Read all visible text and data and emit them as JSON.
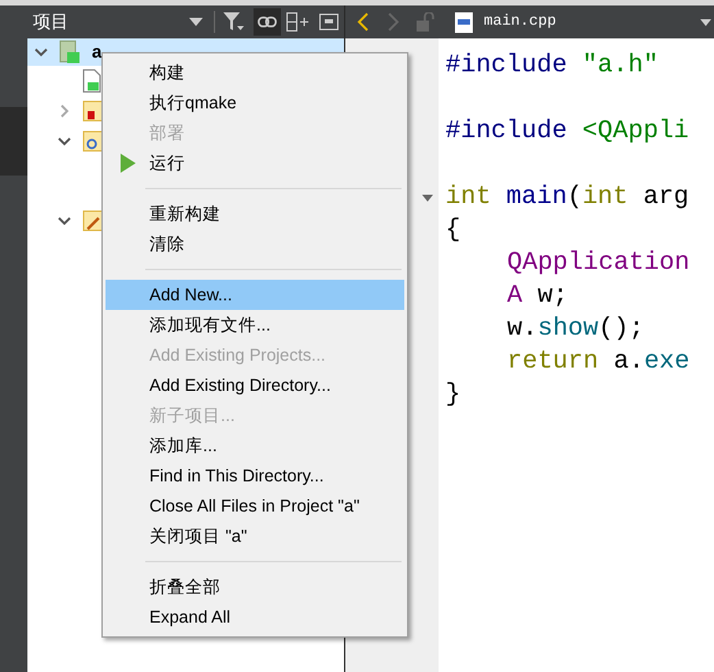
{
  "projects_header": {
    "title": "项目"
  },
  "editor_toolbar": {
    "file_name": "main.cpp"
  },
  "tree": [
    {
      "label": "a",
      "kind": "project",
      "selected": true,
      "expanded": true,
      "children": [
        {
          "kind": "pro-file"
        },
        {
          "kind": "headers",
          "expanded": false
        },
        {
          "kind": "sources",
          "expanded": true
        },
        {
          "kind": "forms",
          "expanded": true
        }
      ]
    }
  ],
  "context_menu": [
    {
      "label": "构建",
      "disabled": false,
      "selected": false
    },
    {
      "label": "执行qmake",
      "disabled": false,
      "selected": false
    },
    {
      "label": "部署",
      "disabled": true,
      "selected": false
    },
    {
      "kind": "run",
      "label": "运行",
      "disabled": false,
      "selected": false
    },
    {
      "kind": "separator"
    },
    {
      "label": "重新构建",
      "disabled": false,
      "selected": false
    },
    {
      "label": "清除",
      "disabled": false,
      "selected": false
    },
    {
      "kind": "separator"
    },
    {
      "label": "Add New...",
      "disabled": false,
      "selected": true
    },
    {
      "label": "添加现有文件...",
      "disabled": false,
      "selected": false
    },
    {
      "label": "Add Existing Projects...",
      "disabled": true,
      "selected": false
    },
    {
      "label": "Add Existing Directory...",
      "disabled": false,
      "selected": false
    },
    {
      "label": "新子项目...",
      "disabled": true,
      "selected": false
    },
    {
      "label": "添加库...",
      "disabled": false,
      "selected": false
    },
    {
      "label": "Find in This Directory...",
      "disabled": false,
      "selected": false
    },
    {
      "label": "Close All Files in Project \"a\"",
      "disabled": false,
      "selected": false
    },
    {
      "label": "关闭项目 \"a\"",
      "disabled": false,
      "selected": false
    },
    {
      "kind": "separator"
    },
    {
      "label": "折叠全部",
      "disabled": false,
      "selected": false
    },
    {
      "label": "Expand All",
      "disabled": false,
      "selected": false
    }
  ],
  "code_lines": [
    {
      "fold": false,
      "indented": false,
      "tokens": [
        {
          "kind": "preprocessor",
          "text": "#include"
        },
        {
          "kind": "string",
          "text": " \"a.h\""
        }
      ]
    },
    {
      "fold": false,
      "indented": false,
      "gap_before": true,
      "tokens": [
        {
          "kind": "preprocessor",
          "text": "#include"
        },
        {
          "kind": "string",
          "text": " <QAppli"
        }
      ]
    },
    {
      "fold": true,
      "indented": false,
      "gap_before": true,
      "tokens": [
        {
          "kind": "keyword",
          "text": "int"
        },
        {
          "kind": "function",
          "text": " main"
        },
        {
          "kind": "plain",
          "text": "("
        },
        {
          "kind": "keyword",
          "text": "int"
        },
        {
          "kind": "plain",
          "text": " arg"
        }
      ]
    },
    {
      "fold": false,
      "indented": false,
      "tokens": [
        {
          "kind": "plain",
          "text": "{"
        }
      ]
    },
    {
      "fold": false,
      "indented": true,
      "tokens": [
        {
          "kind": "type",
          "text": "QApplication"
        }
      ]
    },
    {
      "fold": false,
      "indented": true,
      "tokens": [
        {
          "kind": "type",
          "text": "A"
        },
        {
          "kind": "plain",
          "text": " w;"
        }
      ]
    },
    {
      "fold": false,
      "indented": true,
      "tokens": [
        {
          "kind": "plain",
          "text": "w."
        },
        {
          "kind": "method",
          "text": "show"
        },
        {
          "kind": "plain",
          "text": "();"
        }
      ]
    },
    {
      "fold": false,
      "indented": true,
      "tokens": [
        {
          "kind": "keyword",
          "text": "return"
        },
        {
          "kind": "plain",
          "text": " a."
        },
        {
          "kind": "method",
          "text": "exe"
        }
      ]
    },
    {
      "fold": false,
      "indented": false,
      "tokens": [
        {
          "kind": "plain",
          "text": "}"
        }
      ]
    }
  ]
}
